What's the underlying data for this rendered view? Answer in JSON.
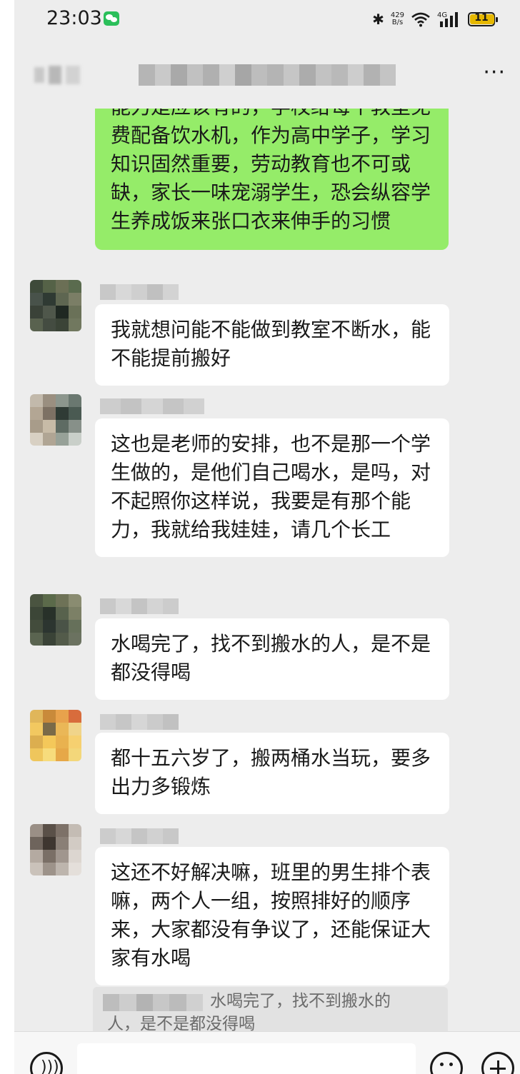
{
  "status_bar": {
    "time": "23:03",
    "net_speed_value": "429",
    "net_speed_unit": "B/s",
    "network": "4G",
    "battery": "11",
    "icons": [
      "wechat-notification-icon",
      "bluetooth-icon",
      "wifi-icon",
      "signal-icon",
      "battery-icon"
    ]
  },
  "header": {
    "title": "(blurred group chat name)",
    "more_icon": "more-icon"
  },
  "colors": {
    "self_bubble": "#95ec69",
    "other_bubble": "#ffffff",
    "background": "#ededed"
  },
  "messages": [
    {
      "sender": "self",
      "text": "能力是应该有的，学校给每个教室免费配备饮水机，作为高中学子，学习知识固然重要，劳动教育也不可或缺，家长一味宠溺学生，恐会纵容学生养成饭来张口衣来伸手的习惯"
    },
    {
      "sender": "other",
      "text": "我就想问能不能做到教室不断水，能不能提前搬好"
    },
    {
      "sender": "other",
      "text": "这也是老师的安排，也不是那一个学生做的，是他们自己喝水，是吗，对不起照你这样说，我要是有那个能力，我就给我娃娃，请几个长工"
    },
    {
      "sender": "other",
      "text": "水喝完了，找不到搬水的人，是不是都没得喝"
    },
    {
      "sender": "other",
      "text": "都十五六岁了，搬两桶水当玩，要多出力多锻炼"
    },
    {
      "sender": "other",
      "text": "这还不好解决嘛，班里的男生排个表嘛，两个人一组，按照排好的顺序来，大家都没有争议了，还能保证大家有水喝"
    }
  ],
  "quote": {
    "text": "水喝完了，找不到搬水的人，是不是都没得喝"
  },
  "input_bar": {
    "message_value": "",
    "icons": [
      "voice-icon",
      "emoji-icon",
      "plus-icon"
    ]
  }
}
